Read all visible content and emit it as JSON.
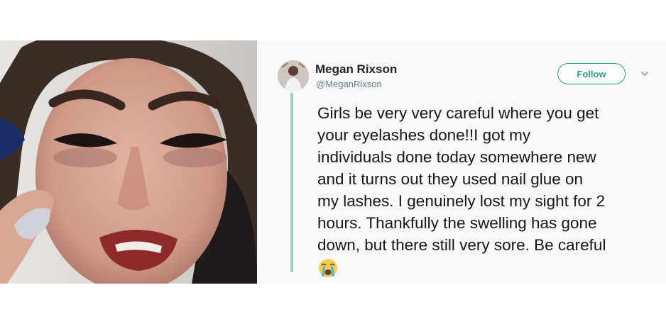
{
  "tweet": {
    "author_name": "Megan Rixson",
    "author_handle": "@MeganRixson",
    "follow_label": "Follow",
    "body_lines": [
      "Girls be very very careful where you get",
      "your eyelashes done!!I got my",
      "individuals done today somewhere new",
      "and it turns out they used nail glue on",
      "my lashes. I genuinely lost my sight for 2",
      "hours. Thankfully the swelling has gone",
      "down, but there still very sore. Be careful"
    ],
    "emoji": "loudly-crying-face-icon"
  },
  "photo": {
    "subject": "crying-woman-photo"
  },
  "colors": {
    "accent": "#2aa37a",
    "thread_line": "#9ed2c1",
    "panel_background": "#f9f9f9"
  }
}
